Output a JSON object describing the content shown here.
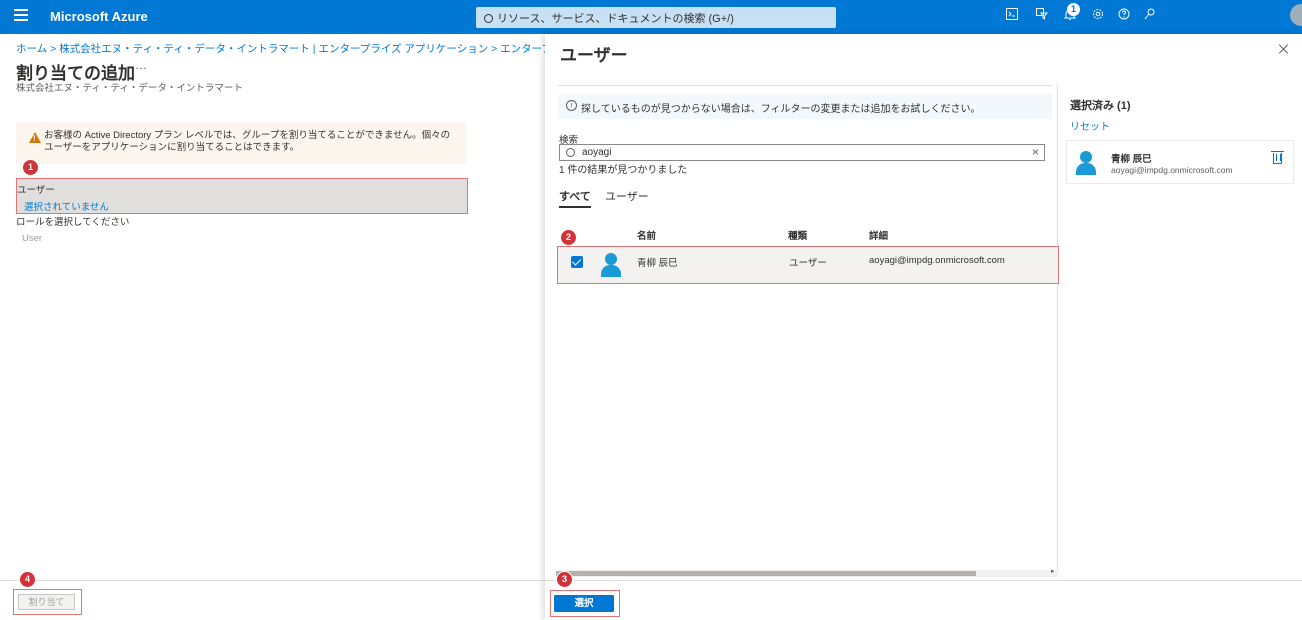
{
  "topbar": {
    "brand": "Microsoft Azure",
    "search_placeholder": "リソース、サービス、ドキュメントの検索 (G+/)",
    "notification_count": "1",
    "icons": [
      "cloud-shell-icon",
      "directory-filter-icon",
      "bell-icon",
      "gear-icon",
      "help-icon",
      "feedback-icon"
    ]
  },
  "left": {
    "breadcrumb": "ホーム > 株式会社エヌ・ティ・ティ・データ・イントラマート | エンタープライズ アプリケーション > エンタープライズ アプリケーション | すべてのアプリケ",
    "title": "割り当ての追加",
    "more": "…",
    "subtitle": "株式会社エヌ・ティ・ティ・データ・イントラマート",
    "warning": "お客様の Active Directory プラン レベルでは、グループを割り当てることができません。個々のユーザーをアプリケーションに割り当てることはできます。",
    "users_label": "ユーザー",
    "users_value": "選択されていません",
    "role_label": "ロールを選択してください",
    "role_value": "User",
    "assign_button": "割り当て"
  },
  "steps": [
    "1",
    "2",
    "3",
    "4"
  ],
  "blade": {
    "title": "ユーザー",
    "info": "探しているものが見つからない場合は、フィルターの変更または追加をお試しください。",
    "search_label": "検索",
    "search_value": "aoyagi",
    "result_count": "1 件の結果が見つかりました",
    "tabs": [
      "すべて",
      "ユーザー"
    ],
    "columns": [
      "名前",
      "種類",
      "詳細"
    ],
    "rows": [
      {
        "name": "青柳 辰巳",
        "type": "ユーザー",
        "detail": "aoyagi@impdg.onmicrosoft.com",
        "checked": true
      }
    ],
    "selected_title": "選択済み (1)",
    "reset": "リセット",
    "selected": [
      {
        "name": "青柳 辰巳",
        "email": "aoyagi@impdg.onmicrosoft.com"
      }
    ],
    "select_button": "選択"
  },
  "colors": {
    "accent": "#0078d4",
    "highlight": "#e07476",
    "step_badge": "#d13438"
  }
}
